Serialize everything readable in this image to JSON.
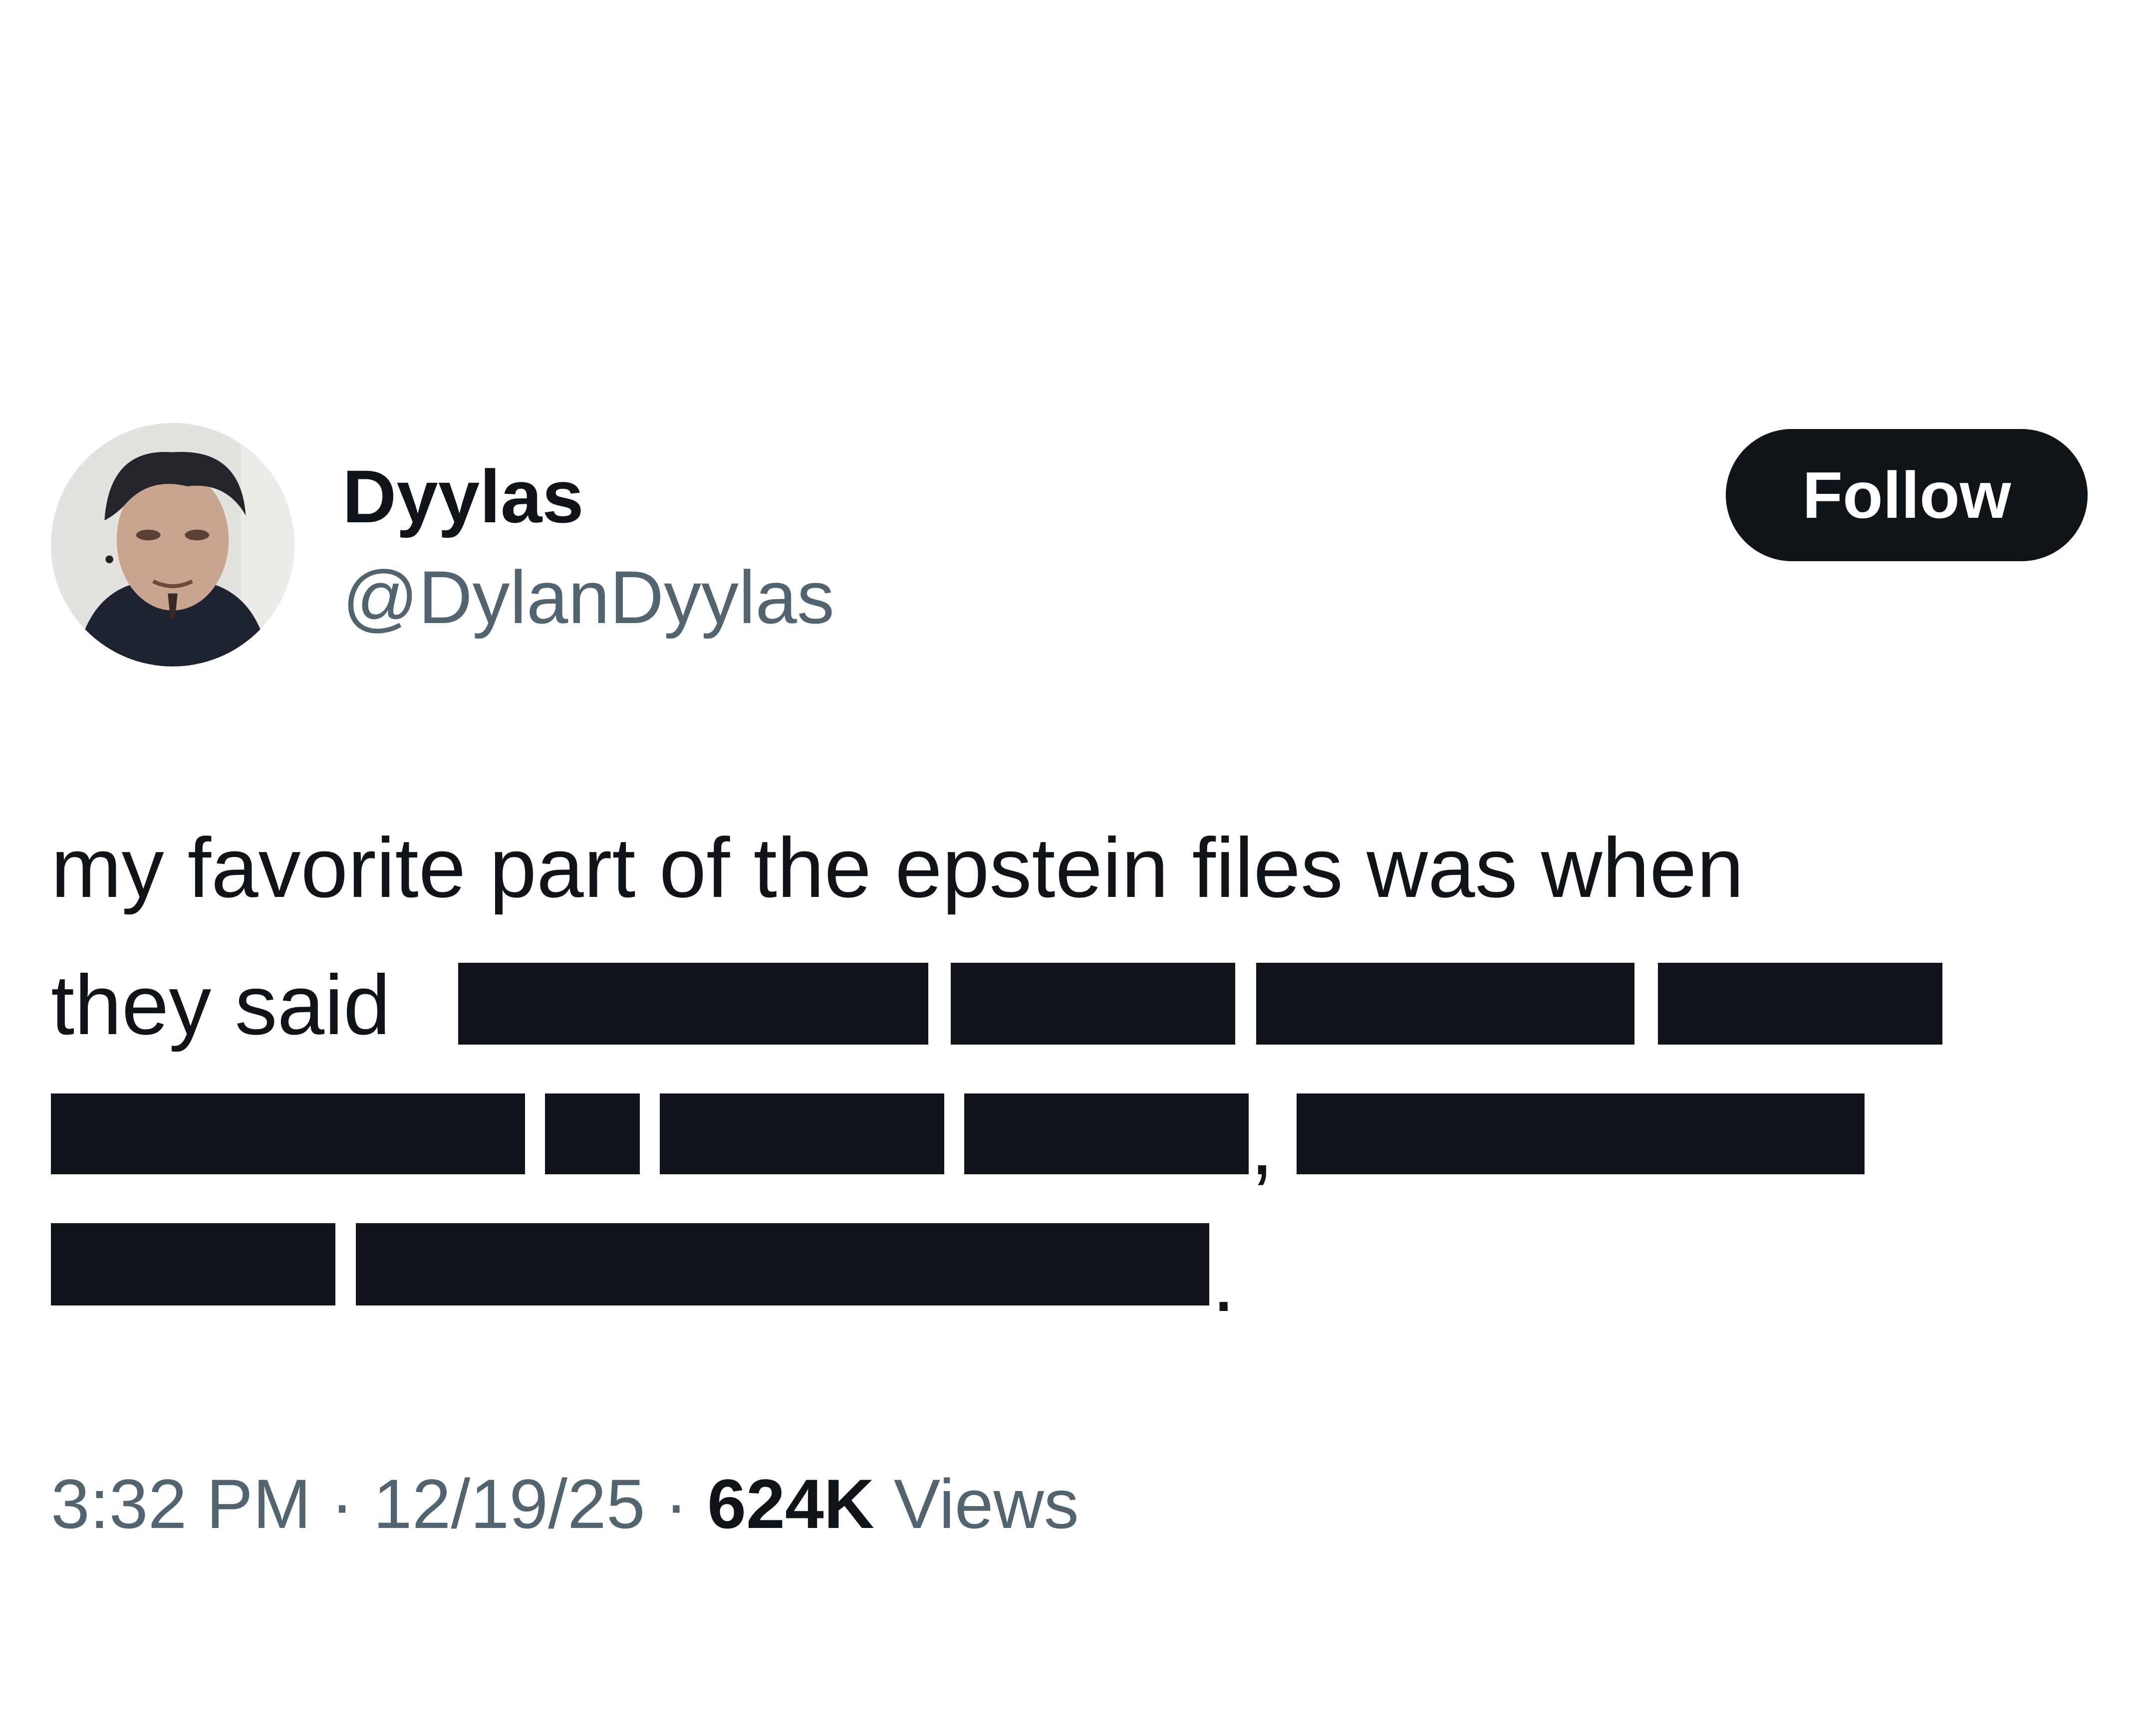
{
  "author": {
    "display_name": "Dyylas",
    "handle": "@DylanDyylas"
  },
  "follow_button": {
    "label": "Follow"
  },
  "tweet": {
    "text_line_1": "my favorite part of the epstein files was when",
    "text_line_2_start": "they said",
    "comma": ",",
    "period": "."
  },
  "meta": {
    "time": "3:32 PM",
    "separator": " · ",
    "date": "12/19/25",
    "views_count": "624K",
    "views_label": "Views"
  },
  "colors": {
    "text": "#0f1419",
    "secondary_text": "#536471",
    "redaction": "#11141a",
    "button_bg": "#0f1419",
    "button_text": "#ffffff",
    "background": "#ffffff"
  }
}
